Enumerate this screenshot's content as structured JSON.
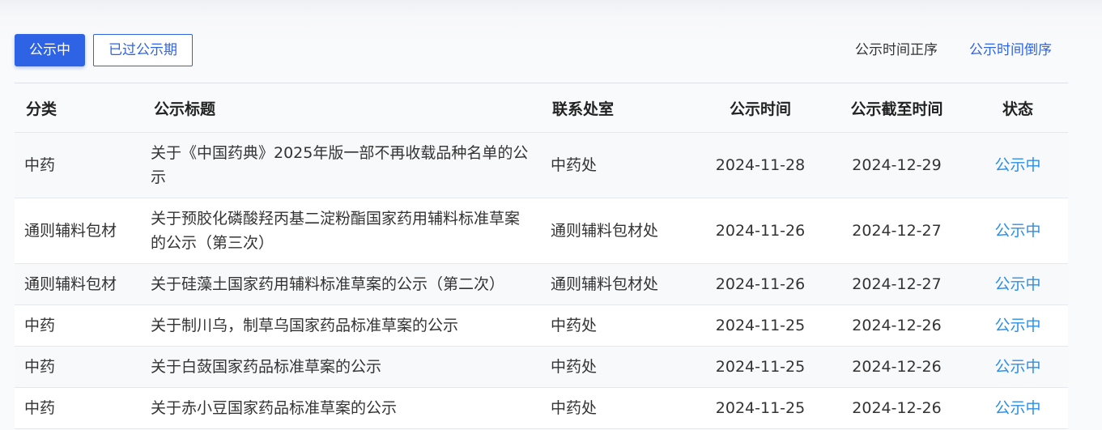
{
  "toolbar": {
    "tab_active": "公示中",
    "tab_expired": "已过公示期",
    "sort_asc": "公示时间正序",
    "sort_desc": "公示时间倒序"
  },
  "table": {
    "headers": {
      "category": "分类",
      "title": "公示标题",
      "department": "联系处室",
      "publish_date": "公示时间",
      "deadline": "公示截至时间",
      "status": "状态"
    },
    "rows": [
      {
        "category": "中药",
        "title": "关于《中国药典》2025年版一部不再收载品种名单的公示",
        "department": "中药处",
        "publish_date": "2024-11-28",
        "deadline": "2024-12-29",
        "status": "公示中"
      },
      {
        "category": "通则辅料包材",
        "title": "关于预胶化磷酸羟丙基二淀粉酯国家药用辅料标准草案的公示（第三次）",
        "department": "通则辅料包材处",
        "publish_date": "2024-11-26",
        "deadline": "2024-12-27",
        "status": "公示中"
      },
      {
        "category": "通则辅料包材",
        "title": "关于硅藻土国家药用辅料标准草案的公示（第二次）",
        "department": "通则辅料包材处",
        "publish_date": "2024-11-26",
        "deadline": "2024-12-27",
        "status": "公示中"
      },
      {
        "category": "中药",
        "title": "关于制川乌，制草乌国家药品标准草案的公示",
        "department": "中药处",
        "publish_date": "2024-11-25",
        "deadline": "2024-12-26",
        "status": "公示中"
      },
      {
        "category": "中药",
        "title": "关于白蔹国家药品标准草案的公示",
        "department": "中药处",
        "publish_date": "2024-11-25",
        "deadline": "2024-12-26",
        "status": "公示中"
      },
      {
        "category": "中药",
        "title": "关于赤小豆国家药品标准草案的公示",
        "department": "中药处",
        "publish_date": "2024-11-25",
        "deadline": "2024-12-26",
        "status": "公示中"
      }
    ]
  }
}
